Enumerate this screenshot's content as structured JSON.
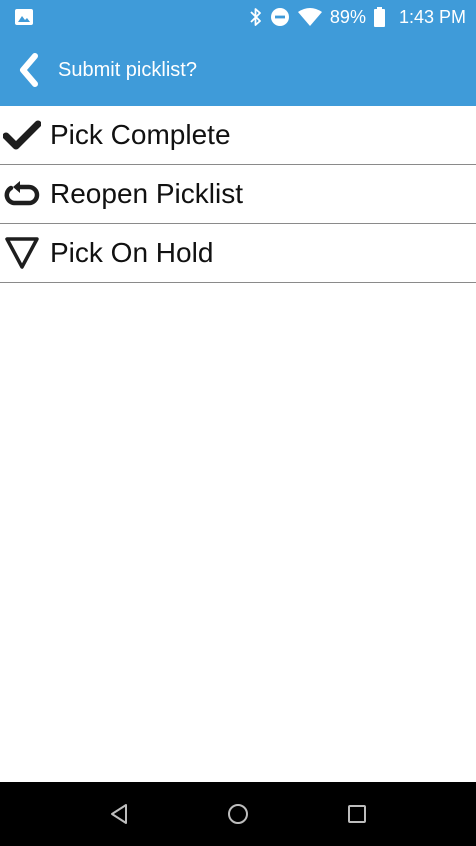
{
  "status_bar": {
    "battery": "89%",
    "time": "1:43 PM"
  },
  "toolbar": {
    "title": "Submit picklist?"
  },
  "actions": [
    {
      "label": "Pick Complete",
      "icon": "checkmark-icon"
    },
    {
      "label": "Reopen Picklist",
      "icon": "reopen-loop-icon"
    },
    {
      "label": "Pick On Hold",
      "icon": "down-triangle-icon"
    }
  ],
  "colors": {
    "header": "#3f9bd9",
    "nav_bar": "#000000",
    "divider": "#8a8a8a"
  }
}
